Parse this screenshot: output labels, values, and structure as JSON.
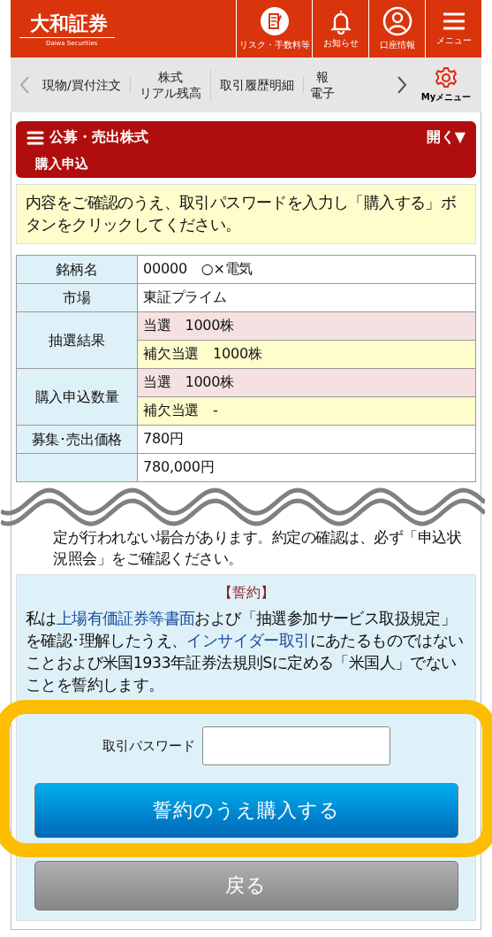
{
  "header": {
    "logo": "大和証券",
    "logo_sub": "Daiwa Securities",
    "actions": [
      {
        "kind": "document",
        "label": "リスク・手数料等"
      },
      {
        "kind": "bell",
        "label": "お知らせ"
      },
      {
        "kind": "person",
        "label": "口座情報"
      },
      {
        "kind": "menu",
        "label": "メニュー"
      }
    ]
  },
  "nav": {
    "items": [
      {
        "lines": [
          "現物/買付注文"
        ]
      },
      {
        "lines": [
          "株式",
          "リアル残高"
        ]
      },
      {
        "lines": [
          "取引履歴明細"
        ]
      },
      {
        "lines": [
          "報",
          "電子"
        ]
      }
    ],
    "my_menu": "Myメニュー"
  },
  "section": {
    "title": "公募・売出株式",
    "toggle": "開く▼",
    "subtitle": "購入申込"
  },
  "notice": "内容をご確認のうえ、取引パスワードを入力し「購入する」ボタンをクリックしてください。",
  "table": {
    "rows": [
      {
        "label": "銘柄名",
        "values": [
          {
            "kind": "plain",
            "text": "00000　○×電気"
          }
        ]
      },
      {
        "label": "市場",
        "values": [
          {
            "kind": "plain",
            "text": "東証プライム"
          }
        ]
      },
      {
        "label": "抽選結果",
        "values": [
          {
            "kind": "won",
            "text": "当選　1000株"
          },
          {
            "kind": "backup",
            "text": "補欠当選　1000株"
          }
        ]
      },
      {
        "label": "購入申込数量",
        "values": [
          {
            "kind": "won",
            "text": "当選　1000株"
          },
          {
            "kind": "backup",
            "text": "補欠当選　-"
          }
        ]
      },
      {
        "label": "募集･売出価格",
        "values": [
          {
            "kind": "plain",
            "text": "780円"
          }
        ]
      },
      {
        "values": [
          {
            "kind": "plain",
            "text": "780,000円"
          }
        ]
      }
    ]
  },
  "note": "定が行われない場合があります。約定の確認は、必ず「申込状況照会」をご確認ください。",
  "oath": {
    "title": "【誓約】",
    "segments": [
      {
        "text": "私は"
      },
      {
        "text": "上場有価証券等書面",
        "link": true
      },
      {
        "text": "および「抽選参加サービス取扱規定」を確認･理解したうえ、"
      },
      {
        "text": "インサイダー取引",
        "link": true
      },
      {
        "text": "にあたるものではないことおよび米国1933年証券法規則Sに定める「米国人」でないことを誓約します。"
      }
    ],
    "password_label": "取引パスワード",
    "submit": "誓約のうえ購入する",
    "back": "戻る"
  }
}
